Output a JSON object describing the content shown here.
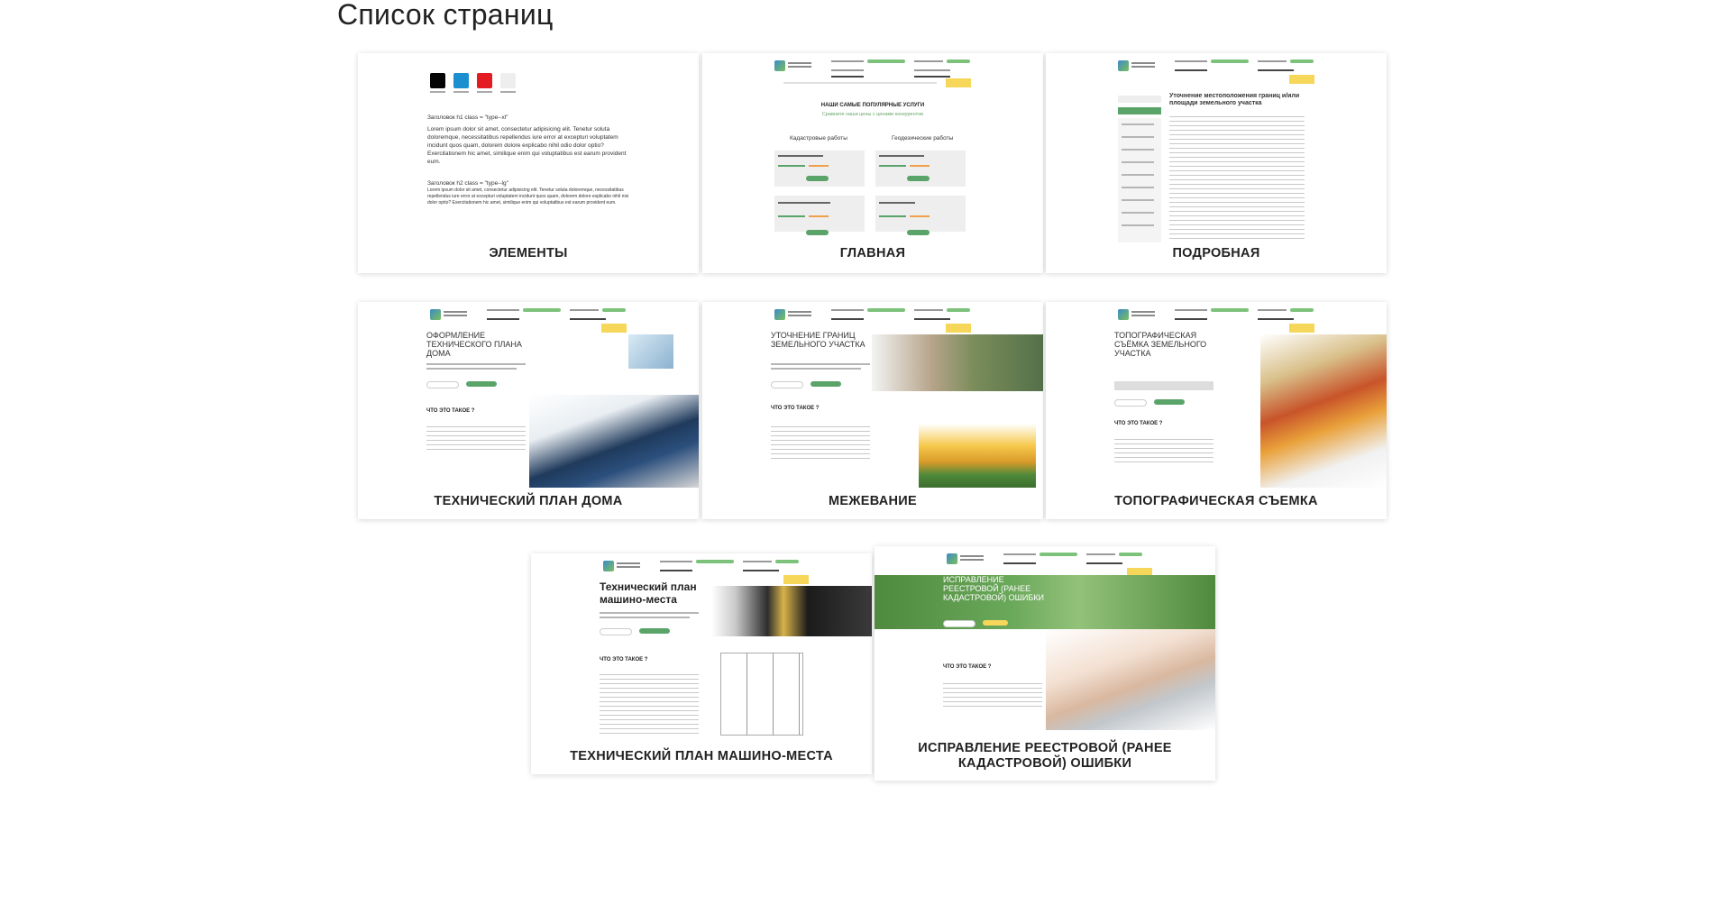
{
  "page": {
    "title": "Список страниц"
  },
  "cards": [
    {
      "label": "ЭЛЕМЕНТЫ"
    },
    {
      "label": "ГЛАВНАЯ"
    },
    {
      "label": "ПОДРОБНАЯ"
    },
    {
      "label": "ТЕХНИЧЕСКИЙ ПЛАН ДОМА"
    },
    {
      "label": "МЕЖЕВАНИЕ"
    },
    {
      "label": "ТОПОГРАФИЧЕСКАЯ СЪЕМКА"
    },
    {
      "label": "ТЕХНИЧЕСКИЙ ПЛАН МАШИНО-МЕСТА"
    },
    {
      "label": "ИСПРАВЛЕНИЕ РЕЕСТРОВОЙ (РАНЕЕ КАДАСТРОВОЙ) ОШИБКИ"
    }
  ],
  "previews": {
    "elements": {
      "h1": "Заголовок h1 class = \"type--xl\"",
      "p1": "Lorem ipsum dolor sit amet, consectetur adipisicing elit. Tenetur soluta doloremque, necessitatibus repellendus iure error at excepturi voluptatem incidunt quos quam, dolorem dolore explicabo nihil odio dolor optio? Exercitationem hic amet, similique enim qui voluptatibus est earum provident eum.",
      "h2": "Заголовок h2 class = \"type--lg\"",
      "p2": "Lorem ipsum dolor sit amet, consectetur adipisicing elit. Tenetur soluta doloremque, necessitatibus repellendus iure error at excepturi voluptatem incidunt quos quam, dolorem dolore explicabo nihil nisi dolor optio? Exercitationem hic amet, similique enim qui voluptatibus est earum provident eum.",
      "swatches": [
        "#050505",
        "#1b8fd0",
        "#e31b23",
        "#eeeeee"
      ]
    },
    "home": {
      "title": "НАШИ САМЫЕ ПОПУЛЯРНЫЕ УСЛУГИ",
      "subtitle": "Сравните наши цены с ценами конкурентов",
      "col1": "Кадастровые работы",
      "col2": "Геодезические работы"
    },
    "detail": {
      "title": "Уточнение местоположения границ и/или площади земельного участка"
    },
    "techplan": {
      "title": "ОФОРМЛЕНИЕ ТЕХНИЧЕСКОГО ПЛАНА ДОМА",
      "what": "ЧТО ЭТО ТАКОЕ ?"
    },
    "survey": {
      "title": "УТОЧНЕНИЕ ГРАНИЦ ЗЕМЕЛЬНОГО УЧАСТКА",
      "what": "ЧТО ЭТО ТАКОЕ ?"
    },
    "topo": {
      "title": "ТОПОГРАФИЧЕСКАЯ СЪЁМКА ЗЕМЕЛЬНОГО УЧАСТКА",
      "what": "ЧТО ЭТО ТАКОЕ ?"
    },
    "parking": {
      "title": "Технический план машино-места",
      "what": "ЧТО ЭТО ТАКОЕ ?"
    },
    "registry": {
      "title": "ИСПРАВЛЕНИЕ РЕЕСТРОВОЙ (РАНЕЕ КАДАСТРОВОЙ) ОШИБКИ",
      "what": "ЧТО ЭТО ТАКОЕ ?"
    }
  }
}
